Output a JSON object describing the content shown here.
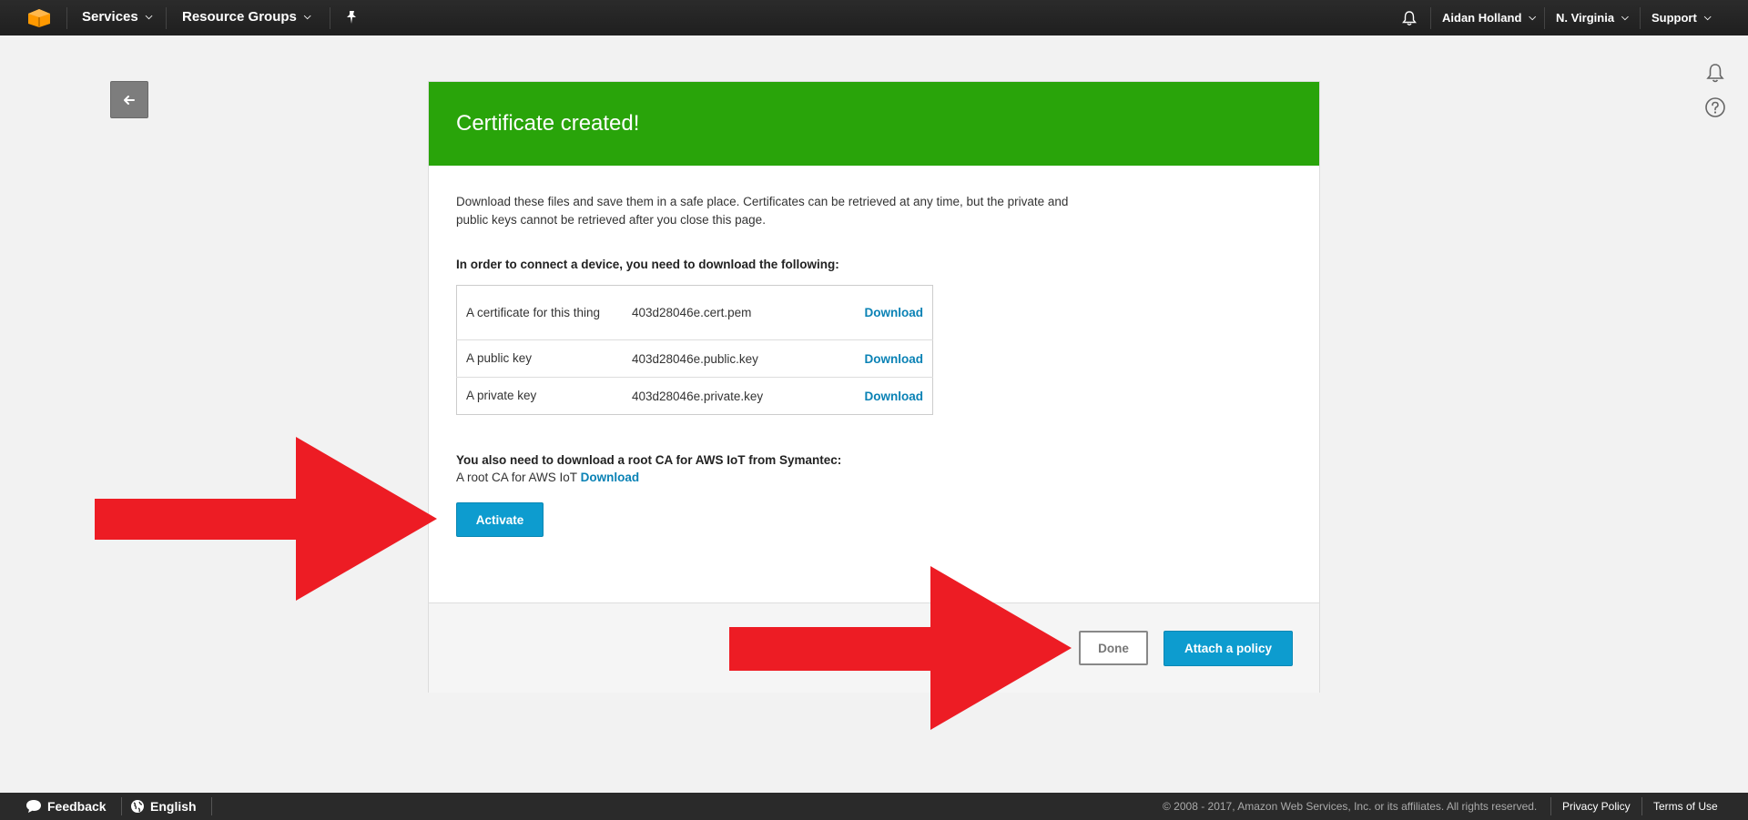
{
  "topnav": {
    "services_label": "Services",
    "resource_groups_label": "Resource Groups",
    "user_label": "Aidan Holland",
    "region_label": "N. Virginia",
    "support_label": "Support"
  },
  "card": {
    "title": "Certificate created!",
    "intro": "Download these files and save them in a safe place. Certificates can be retrieved at any time, but the private and public keys cannot be retrieved after you close this page.",
    "files_heading": "In order to connect a device, you need to download the following:",
    "files": [
      {
        "description": "A certificate for this thing",
        "filename": "403d28046e.cert.pem",
        "action": "Download"
      },
      {
        "description": "A public key",
        "filename": "403d28046e.public.key",
        "action": "Download"
      },
      {
        "description": "A private key",
        "filename": "403d28046e.private.key",
        "action": "Download"
      }
    ],
    "root_ca_heading": "You also need to download a root CA for AWS IoT from Symantec:",
    "root_ca_text": "A root CA for AWS IoT",
    "root_ca_link": "Download",
    "activate_label": "Activate",
    "done_label": "Done",
    "attach_policy_label": "Attach a policy"
  },
  "footer": {
    "feedback_label": "Feedback",
    "language_label": "English",
    "copyright": "© 2008 - 2017, Amazon Web Services, Inc. or its affiliates. All rights reserved.",
    "privacy_label": "Privacy Policy",
    "terms_label": "Terms of Use"
  },
  "colors": {
    "header_green": "#29a40a",
    "primary_blue": "#0d9ccf",
    "link_blue": "#0a82b5",
    "arrow_red": "#ed1c24",
    "nav_dark": "#232323"
  },
  "icons": [
    "aws-logo-icon",
    "pin-icon",
    "bell-icon",
    "arrow-left-icon",
    "help-icon",
    "speech-bubble-icon",
    "globe-icon",
    "chevron-down-icon"
  ]
}
